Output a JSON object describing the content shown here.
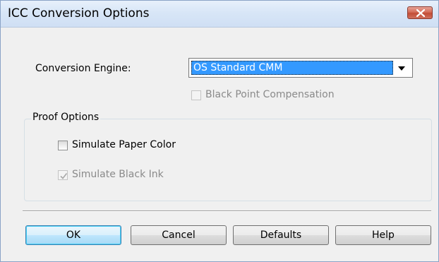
{
  "window": {
    "title": "ICC Conversion Options",
    "close_icon": "close-icon"
  },
  "conversion_engine": {
    "label": "Conversion Engine:",
    "selected_value": "OS Standard CMM"
  },
  "black_point_compensation": {
    "label": "Black Point Compensation",
    "checked": false,
    "enabled": false
  },
  "proof_options": {
    "legend": "Proof Options",
    "simulate_paper_color": {
      "label": "Simulate Paper Color",
      "checked": false,
      "enabled": true
    },
    "simulate_black_ink": {
      "label": "Simulate Black Ink",
      "checked": true,
      "enabled": false
    }
  },
  "buttons": {
    "ok": "OK",
    "cancel": "Cancel",
    "defaults": "Defaults",
    "help": "Help"
  },
  "colors": {
    "titlebar": "#d8e6f7",
    "close_button": "#c24d36",
    "selection": "#3399ff",
    "default_button": "#bee6fd"
  }
}
